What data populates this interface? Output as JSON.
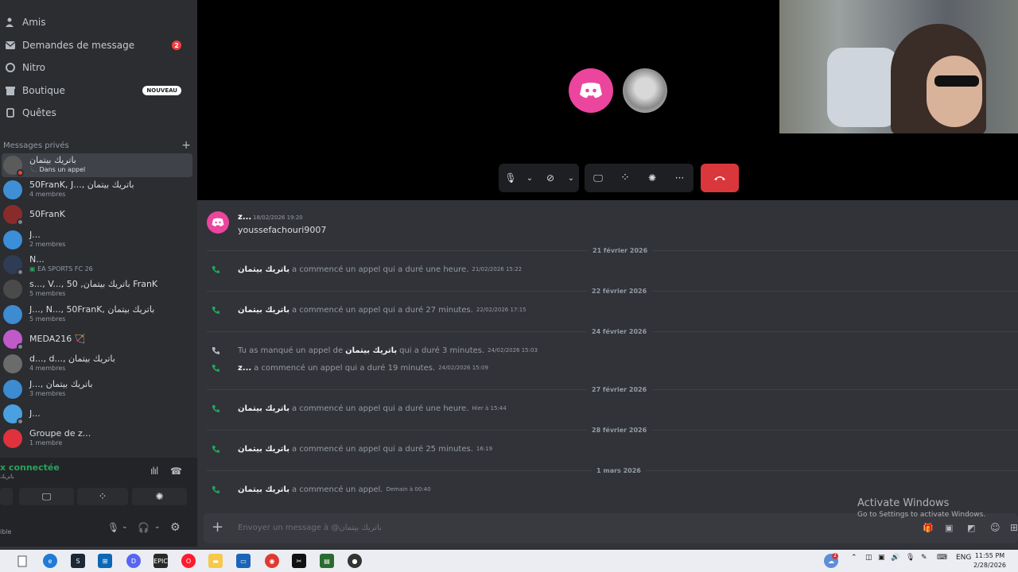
{
  "sidebar": {
    "nav": [
      {
        "label": "Amis",
        "icon": "person-wave-icon"
      },
      {
        "label": "Demandes de message",
        "icon": "envelope-icon",
        "badge": "2"
      },
      {
        "label": "Nitro",
        "icon": "nitro-icon"
      },
      {
        "label": "Boutique",
        "icon": "shop-icon",
        "tag": "NOUVEAU"
      },
      {
        "label": "Quêtes",
        "icon": "quests-icon"
      }
    ],
    "dm_header": "Messages privés",
    "dm_add": "+",
    "dms": [
      {
        "name": "باتريك بيتمان",
        "sub": "Dans un appel",
        "color": "#5b5b5b"
      },
      {
        "name": "50FranK, J..., باتريك بيتمان",
        "sub": "4 membres",
        "color": "#3f8fd6"
      },
      {
        "name": "50FranK",
        "sub": "",
        "color": "#8a2b2b"
      },
      {
        "name": "J...",
        "sub": "2 membres",
        "color": "#3b8ed8"
      },
      {
        "name": "N...",
        "sub": "EA SPORTS FC 26",
        "color": "#2f3c55"
      },
      {
        "name": "s..., V..., 50 ,باتريك بيتمان FranK",
        "sub": "5 membres",
        "color": "#4a4a4a"
      },
      {
        "name": "J..., N..., 50FranK, باتريك بيتمان",
        "sub": "5 membres",
        "color": "#3d8bd1"
      },
      {
        "name": "MEDA216 🏹",
        "sub": "",
        "color": "#c05ac8"
      },
      {
        "name": "d..., d..., باتريك بيتمان",
        "sub": "4 membres",
        "color": "#6b6b6b"
      },
      {
        "name": "J..., باتريك بيتمان",
        "sub": "3 membres",
        "color": "#3d8bd1"
      },
      {
        "name": "J...",
        "sub": "",
        "color": "#4aa0e0"
      },
      {
        "name": "Groupe de z...",
        "sub": "1 membre",
        "color": "#e0323c"
      }
    ],
    "voice": {
      "status": "x connectée",
      "channel": "باتريك",
      "user_status": "ible"
    }
  },
  "call": {
    "hangup_color": "#da373c"
  },
  "chat": {
    "first_message": {
      "author": "z...",
      "time": "18/02/2026 19:20",
      "text": "youssefachouri9007"
    },
    "dividers": [
      "21 février 2026",
      "22 février 2026",
      "24 février 2026",
      "27 février 2026",
      "28 février 2026",
      "1 mars 2026"
    ],
    "events": [
      {
        "actor": "باتريك بيتمان",
        "text": "a commencé un appel qui a duré une heure.",
        "time": "21/02/2026 15:22"
      },
      {
        "actor": "باتريك بيتمان",
        "text": "a commencé un appel qui a duré 27 minutes.",
        "time": "22/02/2026 17:15"
      },
      {
        "prefix": "Tu as manqué un appel de",
        "actor": "باتريك بيتمان",
        "text": "qui a duré 3 minutes.",
        "time": "24/02/2026 15:03"
      },
      {
        "actor": "z...",
        "text": "a commencé un appel qui a duré 19 minutes.",
        "time": "24/02/2026 15:09"
      },
      {
        "actor": "باتريك بيتمان",
        "text": "a commencé un appel qui a duré une heure.",
        "time": "Hier à 15:44"
      },
      {
        "actor": "باتريك بيتمان",
        "text": "a commencé un appel qui a duré 25 minutes.",
        "time": "16:19"
      },
      {
        "actor": "باتريك بيتمان",
        "text": "a commencé un appel.",
        "time": "Demain à 00:40"
      }
    ],
    "composer_placeholder": "Envoyer un message à @باتريك بيتمان"
  },
  "watermark": {
    "line1": "Activate Windows",
    "line2": "Go to Settings to activate Windows."
  },
  "taskbar": {
    "lang": "ENG",
    "time": "11:55 PM",
    "date": "2/28/2026",
    "notif_count": "2"
  }
}
